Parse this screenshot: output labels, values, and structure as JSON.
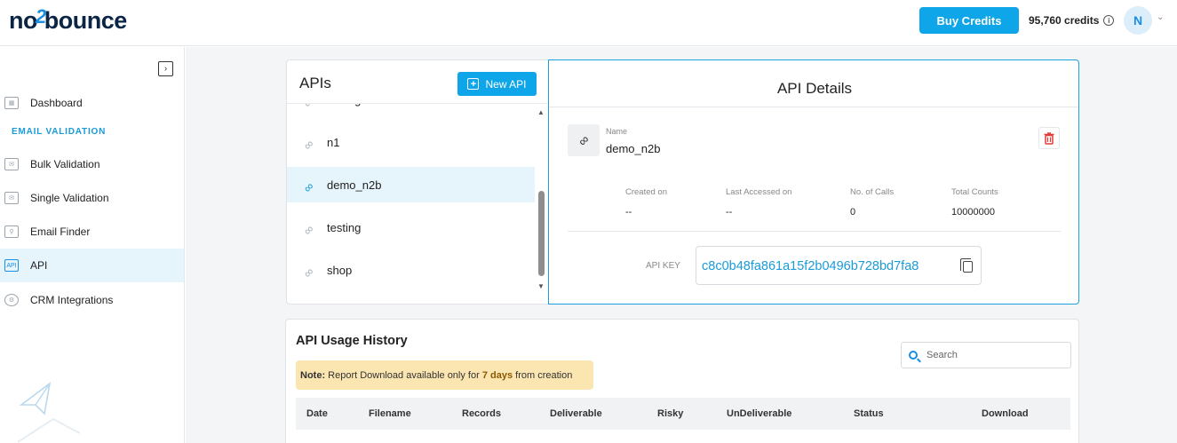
{
  "header": {
    "logo_pre": "no",
    "logo_mid": "2",
    "logo_post": "bounce",
    "buy_credits": "Buy Credits",
    "credits": "95,760 credits",
    "avatar_initial": "N"
  },
  "sidebar": {
    "items": [
      {
        "label": "Dashboard",
        "icon": "dashboard-icon"
      },
      {
        "label": "Bulk Validation",
        "icon": "bulk-validation-icon"
      },
      {
        "label": "Single Validation",
        "icon": "mail-icon"
      },
      {
        "label": "Email Finder",
        "icon": "email-finder-icon"
      },
      {
        "label": "API",
        "icon": "api-icon"
      },
      {
        "label": "CRM Integrations",
        "icon": "crm-icon"
      }
    ],
    "section_label": "EMAIL VALIDATION",
    "active": "API"
  },
  "apis": {
    "title": "APIs",
    "new_button": "New API",
    "items": [
      "testing",
      "n1",
      "demo_n2b",
      "testing",
      "shop"
    ],
    "selected": "demo_n2b"
  },
  "details": {
    "title": "API Details",
    "name_label": "Name",
    "name_value": "demo_n2b",
    "stats": [
      {
        "label": "Created on",
        "value": "--"
      },
      {
        "label": "Last Accessed on",
        "value": "--"
      },
      {
        "label": "No. of Calls",
        "value": "0"
      },
      {
        "label": "Total Counts",
        "value": "10000000"
      }
    ],
    "api_key_label": "API KEY",
    "api_key": "c8c0b48fa861a15f2b0496b728bd7fa8"
  },
  "usage": {
    "title": "API Usage History",
    "search_placeholder": "Search",
    "note_prefix": "Note:",
    "note_text_1": " Report Download available only for ",
    "note_highlight": "7 days",
    "note_text_2": " from creation",
    "columns": [
      "Date",
      "Filename",
      "Records",
      "Deliverable",
      "Risky",
      "UnDeliverable",
      "Status",
      "Download"
    ]
  },
  "colors": {
    "accent": "#0ea5e9",
    "link": "#1a9bd7",
    "delete": "#e53935",
    "note_bg": "#fbe5b1"
  }
}
